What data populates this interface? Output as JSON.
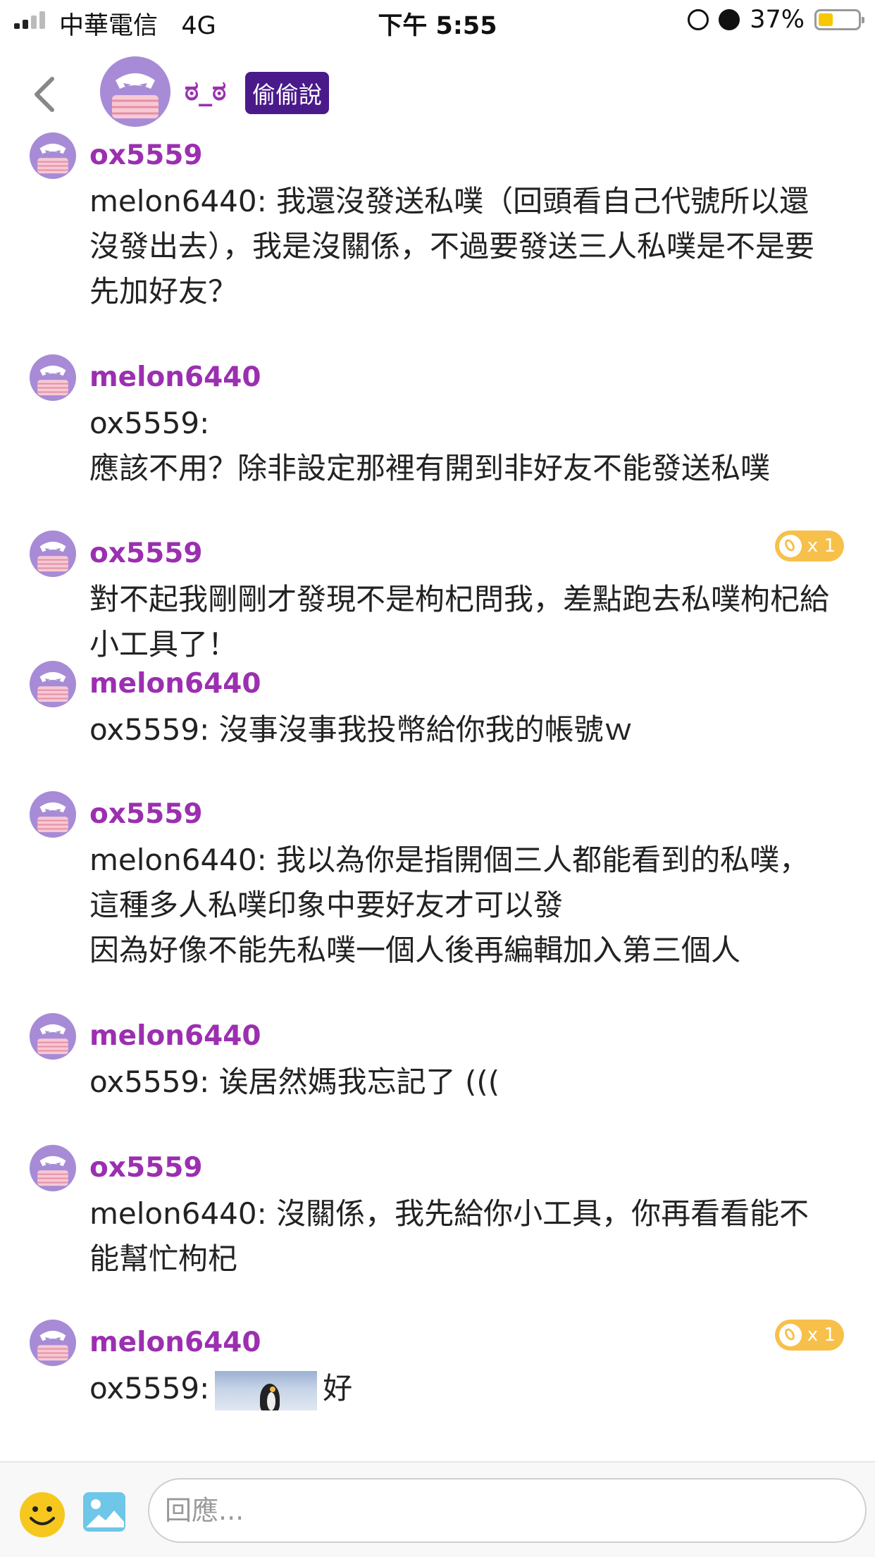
{
  "status_bar": {
    "carrier": "中華電信",
    "network": "4G",
    "time": "下午 5:55",
    "battery_percent": "37%",
    "battery_level": 0.37,
    "battery_color": "#f5c800"
  },
  "header": {
    "back_icon": "chevron-left-icon",
    "title": "ಠ_ಠ",
    "badge": "偷偷說",
    "badge_color": "#4a1a8a"
  },
  "colors": {
    "username": "#9b2fb0",
    "avatar_bg": "#a78bd6",
    "coin": "#f7c04a"
  },
  "messages": [
    {
      "user": "ox5559",
      "text": "melon6440: 我還沒發送私噗（回頭看自己代號所以還沒發出去），我是沒關係，不過要發送三人私噗是不是要先加好友？"
    },
    {
      "user": "melon6440",
      "text": "ox5559:\n應該不用？除非設定那裡有開到非好友不能發送私噗"
    },
    {
      "user": "ox5559",
      "text": "對不起我剛剛才發現不是枸杞問我，差點跑去私噗枸杞給小工具了！",
      "coin": "x 1"
    },
    {
      "user": "melon6440",
      "text": "ox5559: 沒事沒事我投幣給你我的帳號ｗ"
    },
    {
      "user": "ox5559",
      "text": "melon6440: 我以為你是指開個三人都能看到的私噗，這種多人私噗印象中要好友才可以發\n因為好像不能先私噗一個人後再編輯加入第三個人"
    },
    {
      "user": "melon6440",
      "text": "ox5559: 诶居然媽我忘記了 ((("
    },
    {
      "user": "ox5559",
      "text": "melon6440: 沒關係，我先給你小工具，你再看看能不能幫忙枸杞"
    },
    {
      "user": "melon6440",
      "text_prefix": "ox5559:",
      "text_suffix": "好",
      "coin": "x 1",
      "image": "penguin-photo"
    }
  ],
  "composer": {
    "emoji_icon": "smiley-icon",
    "image_icon": "image-icon",
    "placeholder": "回應..."
  }
}
